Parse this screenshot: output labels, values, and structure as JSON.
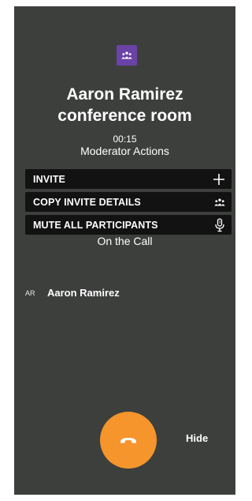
{
  "room": {
    "icon": "people-group-icon",
    "title_line1": "Aaron Ramirez",
    "title_line2": "conference room",
    "timer": "00:15"
  },
  "moderator": {
    "heading": "Moderator Actions",
    "actions": [
      {
        "label": "INVITE",
        "icon": "plus-icon"
      },
      {
        "label": "COPY INVITE DETAILS",
        "icon": "people-group-icon"
      },
      {
        "label": "MUTE ALL PARTICIPANTS",
        "icon": "microphone-icon"
      }
    ]
  },
  "participants": {
    "heading": "On the Call",
    "list": [
      {
        "initials": "AR",
        "name": "Aaron Ramirez"
      }
    ]
  },
  "controls": {
    "hangup_icon": "phone-hangup-icon",
    "hide_label": "Hide"
  },
  "colors": {
    "panel": "#3d3f3d",
    "room_icon_bg": "#6b43a6",
    "button_bg": "#121212",
    "hangup": "#f5952c"
  }
}
